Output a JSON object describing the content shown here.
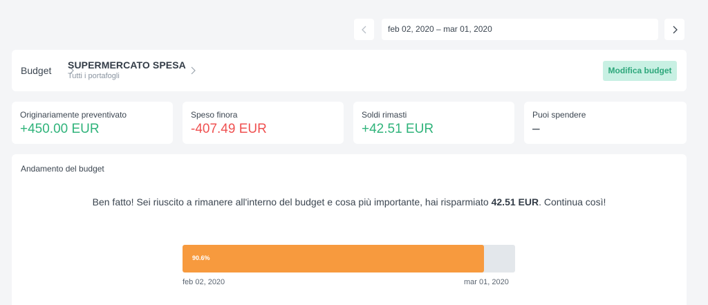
{
  "date_range": "feb 02, 2020 – mar 01, 2020",
  "breadcrumb": {
    "root": "Budget",
    "title": "SUPERMERCATO SPESA",
    "subtitle": "Tutti i portafogli"
  },
  "edit_button": "Modifica budget",
  "stats": [
    {
      "label": "Originariamente preventivato",
      "value": "+450.00 EUR",
      "color": "#2fb37a"
    },
    {
      "label": "Speso finora",
      "value": "-407.49 EUR",
      "color": "#ef5050"
    },
    {
      "label": "Soldi rimasti",
      "value": "+42.51 EUR",
      "color": "#2fb37a"
    },
    {
      "label": "Puoi spendere",
      "value": "–",
      "color": "#3b4550"
    }
  ],
  "chart": {
    "title": "Andamento del budget",
    "message_before": "Ben fatto! Sei riuscito a rimanere all'interno del budget e cosa più importante, hai risparmiato ",
    "message_amount": "42.51 EUR",
    "message_after": ". Continua così!",
    "progress_label": "90.6%",
    "progress_value": 0.906,
    "start_date": "feb 02, 2020",
    "end_date": "mar 01, 2020"
  },
  "icons": {
    "prev": "chevron-left-icon",
    "next": "chevron-right-icon",
    "breadcrumb_separator": "chevron-right-icon"
  },
  "colors": {
    "accent_green": "#2fb37a",
    "negative_red": "#ef5050",
    "progress_orange": "#f79a3e",
    "button_bg": "#c8f0e3"
  }
}
